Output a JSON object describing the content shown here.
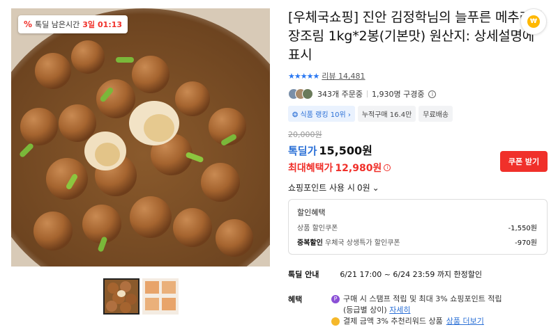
{
  "badge": {
    "icon": "%",
    "label": "톡딜 남은시간",
    "days": "3일",
    "time": "01:13"
  },
  "title": "[우체국쇼핑] 진안 김정학님의 늘푸른 메추리알 장조림 1kg*2봉(기본맛) 원산지: 상세설명에 표시",
  "rating": {
    "stars": "★★★★★",
    "review_text": "리뷰 14,481",
    "star_color": "#2a78f2"
  },
  "stats": {
    "orders": "343개 주문중",
    "subscribers": "1,930명 구경중"
  },
  "tags": [
    {
      "label": "❂ 식품 랭킹 10위 ›",
      "kind": "rank"
    },
    {
      "label": "누적구매 16.4만",
      "kind": "plain"
    },
    {
      "label": "무료배송",
      "kind": "plain"
    }
  ],
  "price": {
    "original": "20,000원",
    "deal_label": "톡딜가",
    "deal_value": "15,500원",
    "max_label": "최대혜택가",
    "max_value": "12,980원",
    "coupon_button": "쿠폰 받기"
  },
  "points": {
    "label": "쇼핑포인트 사용 시",
    "value": "0원",
    "chevron": "⌄"
  },
  "benefit_box": {
    "title": "할인혜택",
    "lines": [
      {
        "label_bold": "",
        "label": "상품 할인쿠폰",
        "amount": "-1,550원"
      },
      {
        "label_bold": "중복할인",
        "label": "우체국 상생특가 할인쿠폰",
        "amount": "-970원"
      }
    ]
  },
  "deal_info": {
    "label": "톡딜 안내",
    "value": "6/21 17:00 ~ 6/24 23:59 까지 한정할인"
  },
  "perks": {
    "label": "혜택",
    "line1": "구매 시 스탬프 적립 및 최대 3% 쇼핑포인트 적립",
    "line2_prefix": "(등급별 상이)",
    "line2_link": "자세히",
    "line3": "결제 금액 3% 추천리워드 상품",
    "line3_link": "상품 더보기"
  },
  "colors": {
    "accent_blue": "#2a6fd6",
    "accent_red": "#f0302a"
  }
}
